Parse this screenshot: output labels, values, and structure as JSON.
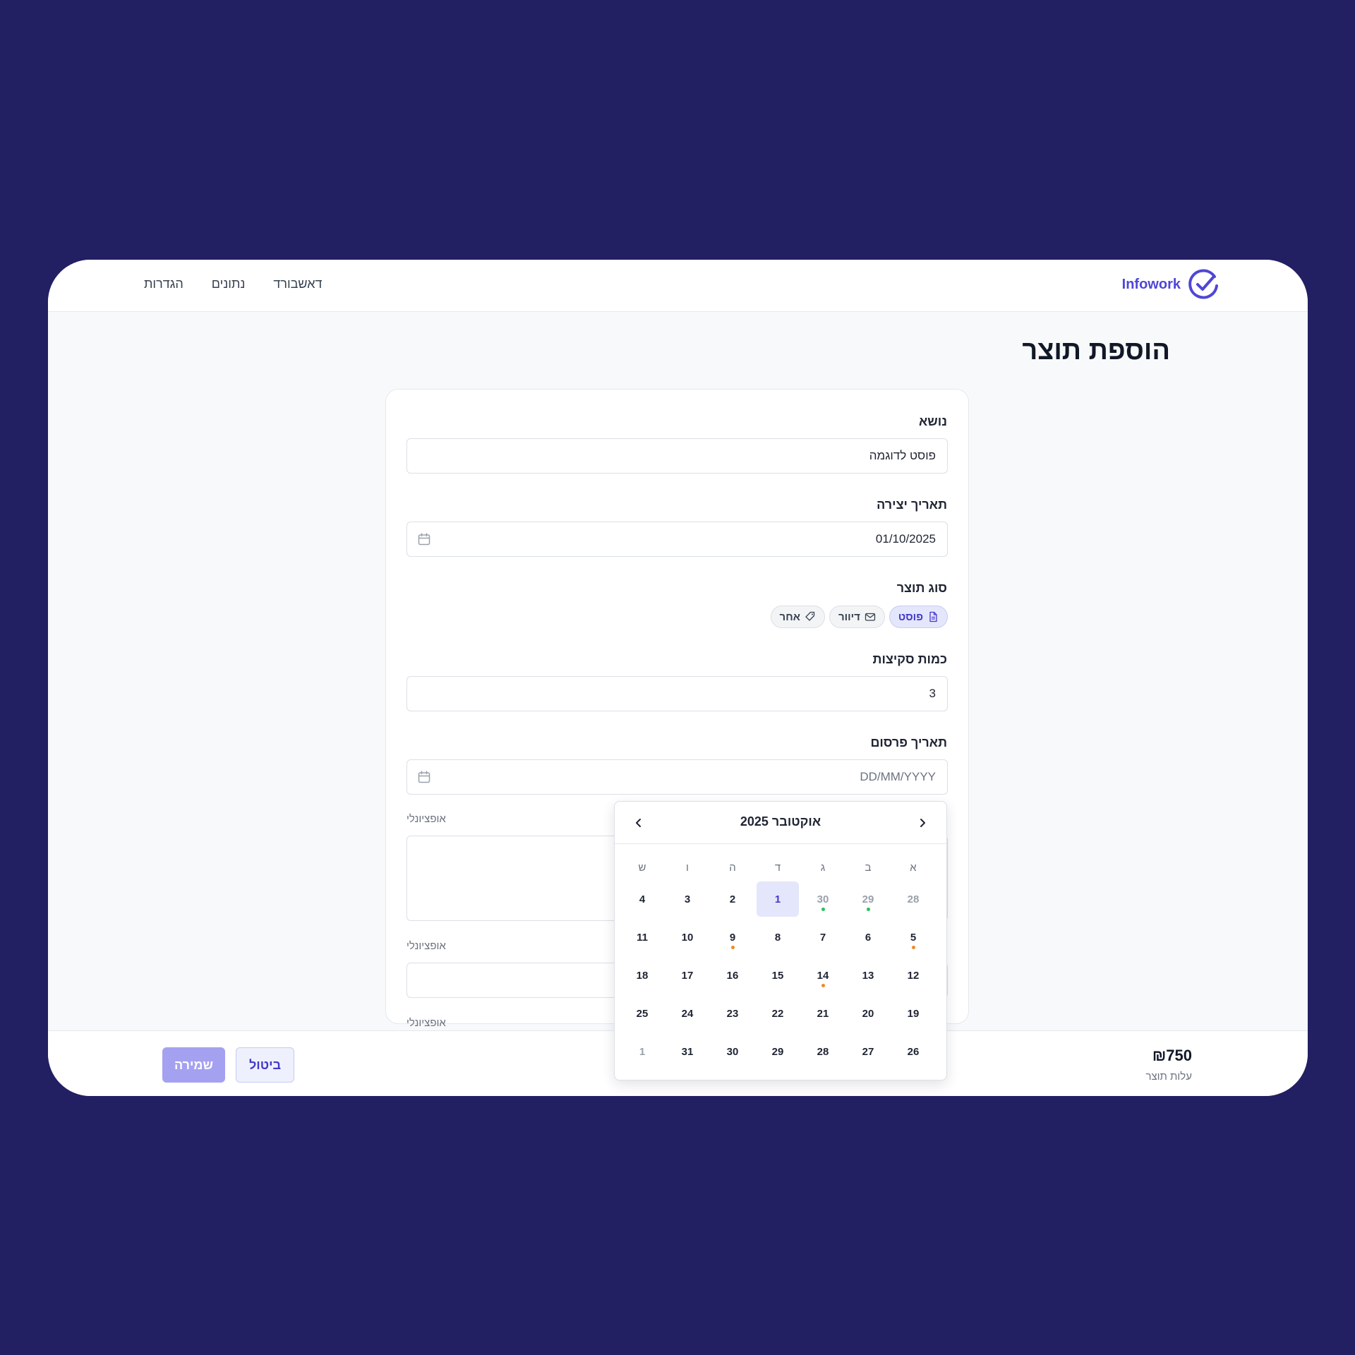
{
  "brand": {
    "name": "Infowork",
    "color": "#4f46d6"
  },
  "nav": {
    "items": [
      "דאשבורד",
      "נתונים",
      "הגדרות"
    ]
  },
  "page": {
    "title": "הוספת תוצר"
  },
  "form": {
    "subject": {
      "label": "נושא",
      "value": "פוסט לדוגמה"
    },
    "created": {
      "label": "תאריך יצירה",
      "value": "01/10/2025"
    },
    "type": {
      "label": "סוג תוצר",
      "options": [
        {
          "label": "פוסט",
          "icon": "document-icon",
          "active": true
        },
        {
          "label": "דיוור",
          "icon": "mail-icon",
          "active": false
        },
        {
          "label": "אחר",
          "icon": "tag-icon",
          "active": false
        }
      ]
    },
    "quantity": {
      "label": "כמות סקיצות",
      "value": "3"
    },
    "publish": {
      "label": "תאריך פרסום",
      "placeholder": "DD/MM/YYYY"
    },
    "optional_1": "אופציונלי",
    "optional_2": "אופציונלי",
    "optional_3": "אופציונלי"
  },
  "calendar": {
    "title": "אוקטובר 2025",
    "weekdays": [
      "א",
      "ב",
      "ג",
      "ד",
      "ה",
      "ו",
      "ש"
    ],
    "weeks": [
      [
        {
          "d": "28",
          "muted": true
        },
        {
          "d": "29",
          "muted": true,
          "dot": "green"
        },
        {
          "d": "30",
          "muted": true,
          "dot": "green"
        },
        {
          "d": "1",
          "selected": true
        },
        {
          "d": "2"
        },
        {
          "d": "3"
        },
        {
          "d": "4"
        }
      ],
      [
        {
          "d": "5",
          "dot": "orange"
        },
        {
          "d": "6"
        },
        {
          "d": "7"
        },
        {
          "d": "8"
        },
        {
          "d": "9",
          "dot": "orange"
        },
        {
          "d": "10"
        },
        {
          "d": "11"
        }
      ],
      [
        {
          "d": "12"
        },
        {
          "d": "13"
        },
        {
          "d": "14",
          "dot": "orange"
        },
        {
          "d": "15"
        },
        {
          "d": "16"
        },
        {
          "d": "17"
        },
        {
          "d": "18"
        }
      ],
      [
        {
          "d": "19"
        },
        {
          "d": "20"
        },
        {
          "d": "21"
        },
        {
          "d": "22"
        },
        {
          "d": "23"
        },
        {
          "d": "24"
        },
        {
          "d": "25"
        }
      ],
      [
        {
          "d": "26"
        },
        {
          "d": "27"
        },
        {
          "d": "28"
        },
        {
          "d": "29"
        },
        {
          "d": "30"
        },
        {
          "d": "31"
        },
        {
          "d": "1",
          "muted": true
        }
      ]
    ],
    "dot_colors": {
      "green": "#22c55e",
      "orange": "#f08a24"
    }
  },
  "footer": {
    "cost_value": "₪750",
    "cost_label": "עלות תוצר",
    "cancel_label": "ביטול",
    "save_label": "שמירה"
  }
}
